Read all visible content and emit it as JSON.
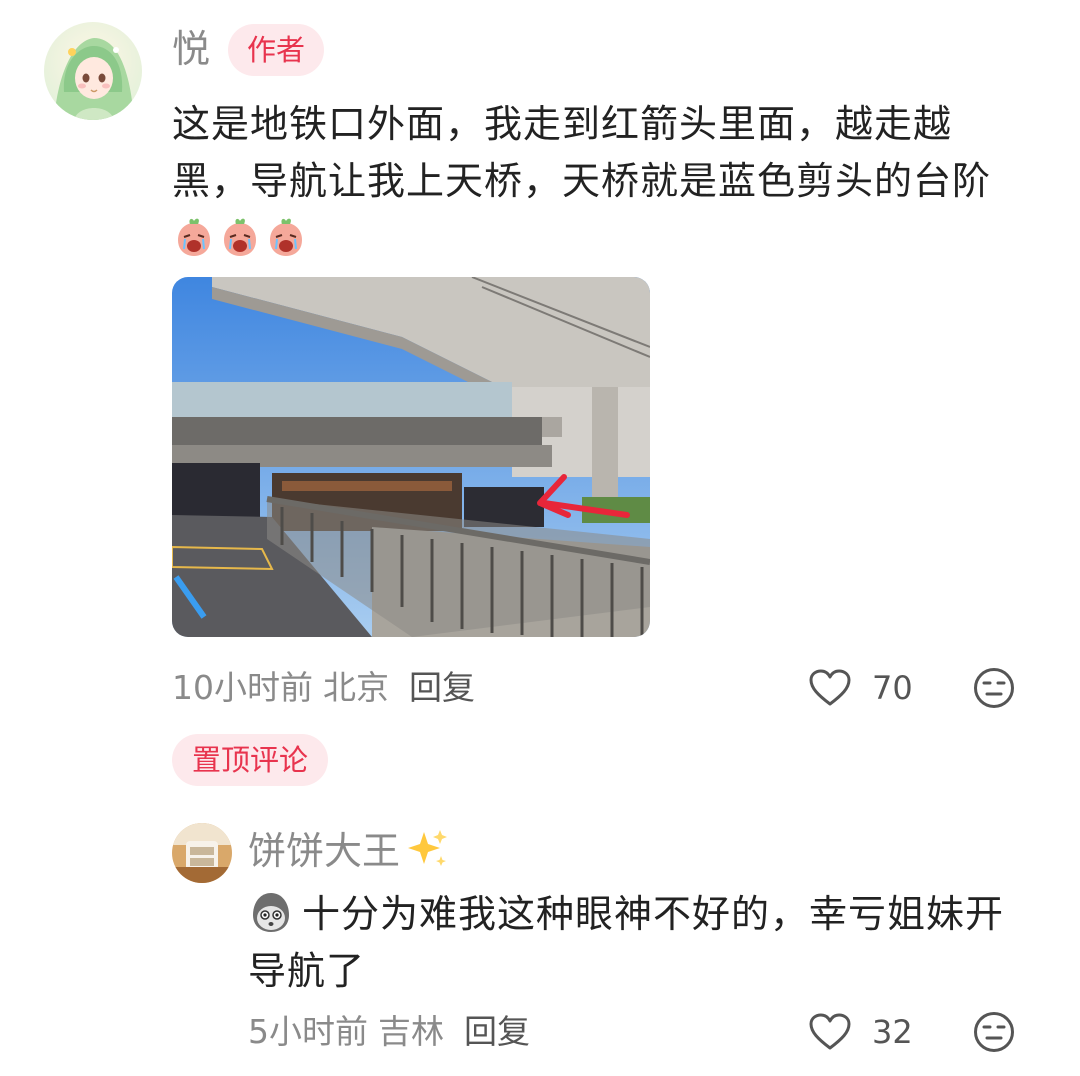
{
  "main_comment": {
    "username": "悦",
    "badge": "作者",
    "text": "这是地铁口外面，我走到红箭头里面，越走越黑，导航让我上天桥，天桥就是蓝色剪头的台阶",
    "inline_emojis": [
      "crying-peach-emoji",
      "crying-peach-emoji",
      "crying-peach-emoji"
    ],
    "image": {
      "type": "photo",
      "description_icon": "photo"
    },
    "meta": {
      "time": "10小时前",
      "location": "北京",
      "reply_label": "回复"
    },
    "likes": "70"
  },
  "pinned_label": "置顶评论",
  "reply_comment": {
    "username": "饼饼大王",
    "name_emoji": "sparkles-emoji",
    "lead_emoji": "gray-face-emoji",
    "text": "十分为难我这种眼神不好的，幸亏姐妹开导航了",
    "meta": {
      "time": "5小时前",
      "location": "吉林",
      "reply_label": "回复"
    },
    "likes": "32"
  },
  "colors": {
    "accent": "#e8344e",
    "badge_bg": "#fde9ec",
    "meta_gray": "#8a8a8a",
    "text": "#222222"
  }
}
